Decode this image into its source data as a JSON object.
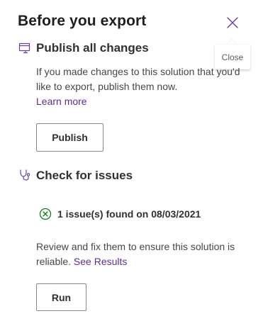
{
  "panel": {
    "title": "Before you export",
    "close_tooltip": "Close"
  },
  "publish_section": {
    "heading": "Publish all changes",
    "description": "If you made changes to this solution that you'd like to export, publish them now.",
    "learn_more_link": "Learn more",
    "publish_button": "Publish"
  },
  "issues_section": {
    "heading": "Check for issues",
    "status_text": "1 issue(s) found on 08/03/2021",
    "description": "Review and fix them to ensure this solution is reliable.",
    "see_results_link": "See Results",
    "run_button": "Run"
  },
  "colors": {
    "link": "#5c2e91",
    "success_icon": "#107c10",
    "accent_icon": "#6b3fa0"
  },
  "icons": {
    "close": "close-icon",
    "publish": "publish-icon",
    "check": "stethoscope-icon",
    "status": "checkmark-circle-icon"
  }
}
